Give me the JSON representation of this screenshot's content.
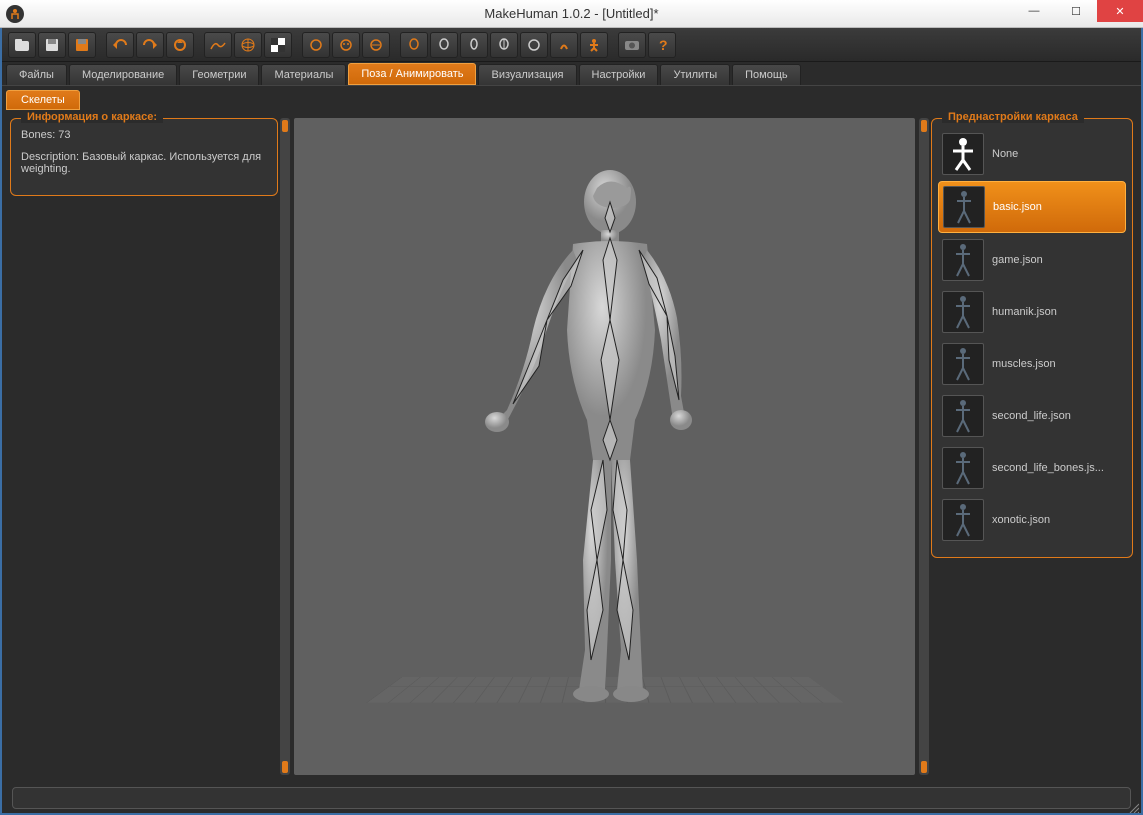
{
  "window": {
    "title": "MakeHuman 1.0.2 - [Untitled]*",
    "minimize": "—",
    "maximize": "☐",
    "close": "✕"
  },
  "toolbar": {
    "icons": [
      "folder",
      "save",
      "save-as",
      "undo",
      "redo",
      "reset",
      "mesh",
      "globe",
      "checker",
      "head-1",
      "face-1",
      "face-2",
      "face-3",
      "view-1",
      "view-2",
      "view-3",
      "view-4",
      "view-5",
      "pose-1",
      "pose-2",
      "camera",
      "help"
    ]
  },
  "tabs": {
    "main": [
      "Файлы",
      "Моделирование",
      "Геометрии",
      "Материалы",
      "Поза / Анимировать",
      "Визуализация",
      "Настройки",
      "Утилиты",
      "Помощь"
    ],
    "main_active": 4,
    "sub": [
      "Скелеты"
    ]
  },
  "info": {
    "title": "Информация о каркасе:",
    "bones_label": "Bones: 73",
    "description": "Description: Базовый каркас. Используется для weighting."
  },
  "presets": {
    "title": "Преднастройки каркаса",
    "items": [
      "None",
      "basic.json",
      "game.json",
      "humanik.json",
      "muscles.json",
      "second_life.json",
      "second_life_bones.js...",
      "xonotic.json"
    ],
    "selected": 1
  }
}
